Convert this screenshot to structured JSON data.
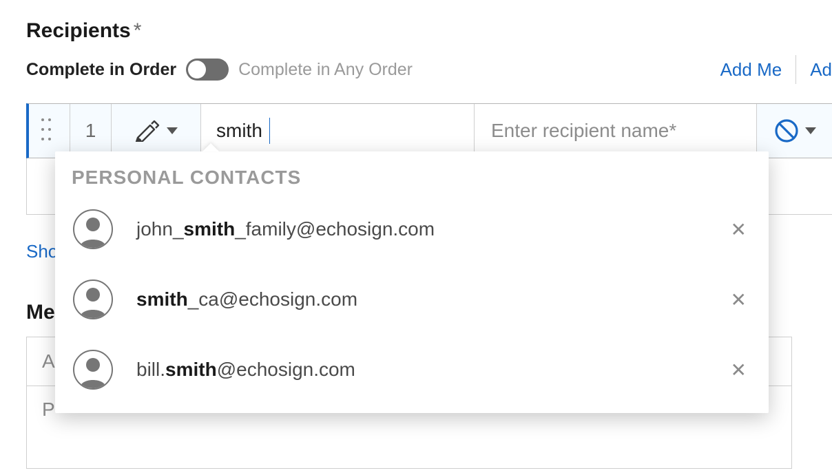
{
  "section": {
    "title": "Recipients",
    "required_mark": "*"
  },
  "order": {
    "complete_in_order": "Complete in Order",
    "complete_any_order": "Complete in Any Order"
  },
  "links": {
    "add_me": "Add Me",
    "add_recipients": "Ad"
  },
  "recipient": {
    "order_number": "1",
    "email_value": "smith",
    "name_placeholder": "Enter recipient name*"
  },
  "autocomplete": {
    "header": "PERSONAL CONTACTS",
    "items": [
      {
        "pre": "john_",
        "match": "smith",
        "post": "_family@echosign.com"
      },
      {
        "pre": "",
        "match": "smith",
        "post": "_ca@echosign.com"
      },
      {
        "pre": "bill.",
        "match": "smith",
        "post": "@echosign.com"
      }
    ]
  },
  "show_link": "Sho",
  "message": {
    "title_prefix": "Me",
    "subject_prefix": "A",
    "body_prefix": "P"
  }
}
